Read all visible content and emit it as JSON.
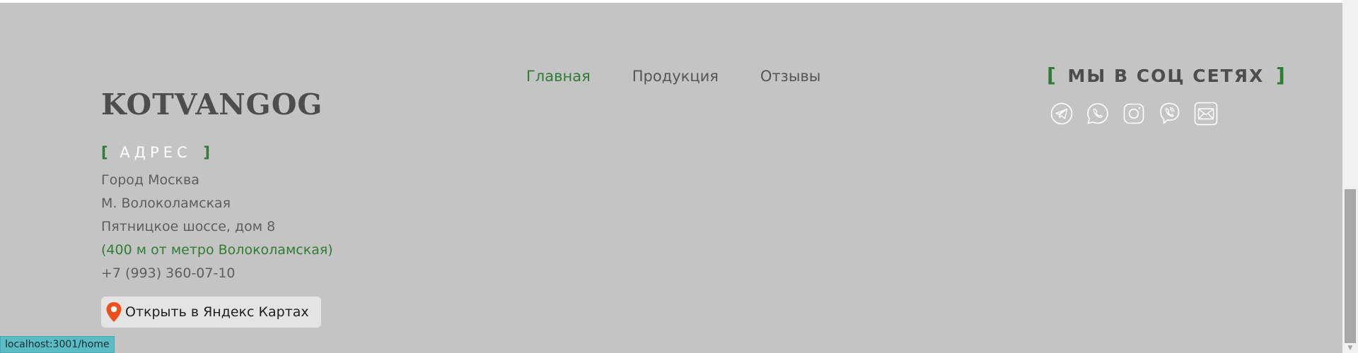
{
  "brand": {
    "logo": "KOTVANGOG"
  },
  "address": {
    "heading": "АДРЕС",
    "bracket_open": "[",
    "bracket_close": "]",
    "lines": [
      "Город Москва",
      "М. Волоколамская",
      "Пятницкое шоссе, дом 8",
      "(400 м от метро Волоколамская)",
      "+7 (993) 360-07-10"
    ]
  },
  "map_button": {
    "label": "Открыть в Яндекс Картах",
    "icon": "map-pin-icon"
  },
  "nav": {
    "items": [
      {
        "label": "Главная",
        "active": true
      },
      {
        "label": "Продукция",
        "active": false
      },
      {
        "label": "Отзывы",
        "active": false
      }
    ]
  },
  "social": {
    "heading": "МЫ В СОЦ СЕТЯХ",
    "bracket_open": "[",
    "bracket_close": "]",
    "icons": [
      "telegram-icon",
      "whatsapp-icon",
      "instagram-icon",
      "viber-icon",
      "email-icon"
    ]
  },
  "status_bar": {
    "url": "localhost:3001/home"
  },
  "colors": {
    "background": "#c4c4c4",
    "accent_green": "#2f7d32",
    "text_gray": "#5e5e5e",
    "pin_orange": "#ef4f1a",
    "status_bar": "#5bbcc6"
  }
}
